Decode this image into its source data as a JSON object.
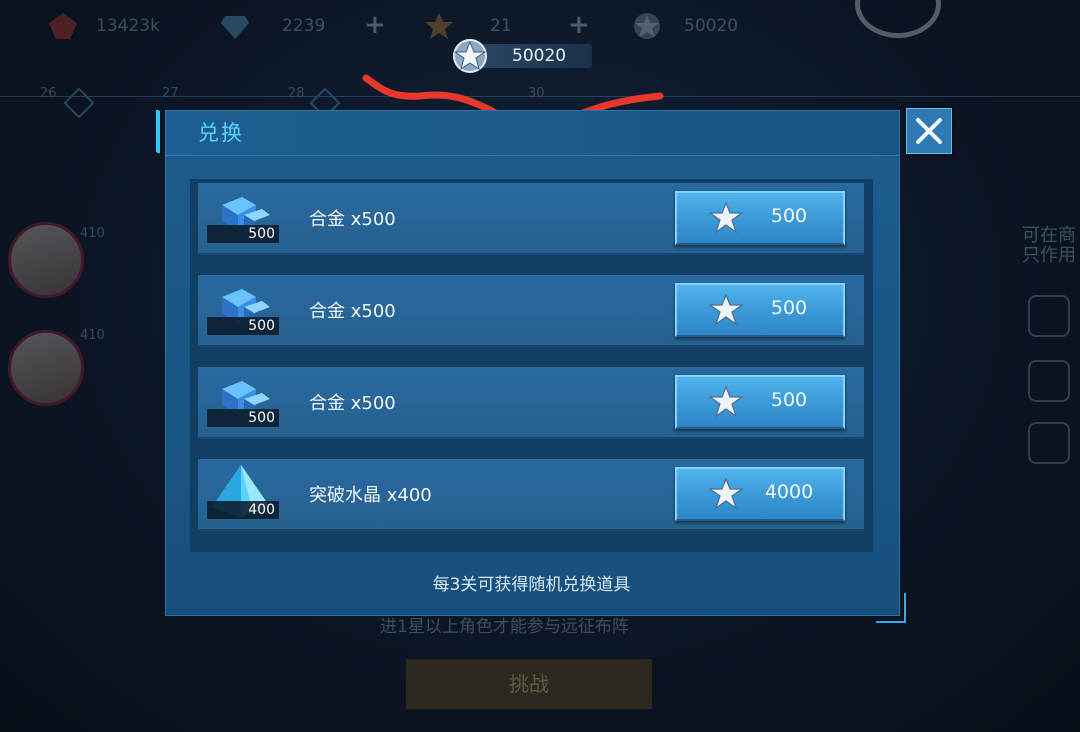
{
  "hud": {
    "resources": [
      {
        "icon": "ruby-icon",
        "value": "13423k"
      },
      {
        "icon": "diamond-icon",
        "value": "2239"
      },
      {
        "icon": "emblem-icon",
        "value": "21"
      },
      {
        "icon": "star-medal-icon",
        "value": "50020"
      }
    ],
    "stages": [
      "26",
      "27",
      "28",
      "30"
    ],
    "current_medals": "50020"
  },
  "background": {
    "levels": [
      "410",
      "410"
    ],
    "side_text": "可在商\n只作用",
    "hint_text": "进1星以上角色才能参与远征布阵",
    "challenge_label": "挑战"
  },
  "modal": {
    "title": "兑换",
    "close_label": "✕",
    "items": [
      {
        "icon": "alloy-icon",
        "qty": "500",
        "name": "合金 x500",
        "price": "500"
      },
      {
        "icon": "alloy-icon",
        "qty": "500",
        "name": "合金 x500",
        "price": "500"
      },
      {
        "icon": "alloy-icon",
        "qty": "500",
        "name": "合金 x500",
        "price": "500"
      },
      {
        "icon": "crystal-icon",
        "qty": "400",
        "name": "突破水晶 x400",
        "price": "4000"
      }
    ],
    "footer": "每3关可获得随机兑换道具"
  },
  "colors": {
    "accent": "#5ad0ff",
    "button": "#3c9ad8",
    "panel": "#1a5788",
    "annotation": "#e8382c"
  }
}
